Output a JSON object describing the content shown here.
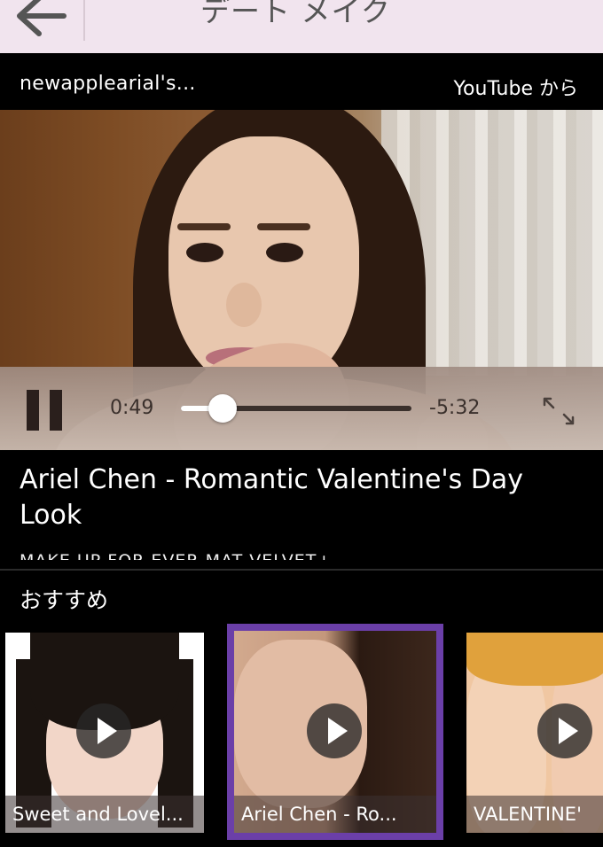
{
  "navbar": {
    "title": "デート メイク"
  },
  "source_row": {
    "channel": "newapplearial's...",
    "source": "YouTube から"
  },
  "player": {
    "elapsed": "0:49",
    "remaining": "-5:32",
    "progress_fraction": 0.18
  },
  "video": {
    "title": "Ariel Chen - Romantic Valentine's Day Look",
    "description": "MAKE UP FOR EVER MAT VELVET+"
  },
  "recommendations": {
    "label": "おすすめ",
    "items": [
      {
        "caption": "Sweet and Lovel..."
      },
      {
        "caption": "Ariel Chen - Ro...",
        "selected": true
      },
      {
        "caption": "VALENTINE'"
      }
    ]
  },
  "colors": {
    "navbar_bg": "#f1e4ee",
    "selected_border": "#6b3fa8"
  }
}
